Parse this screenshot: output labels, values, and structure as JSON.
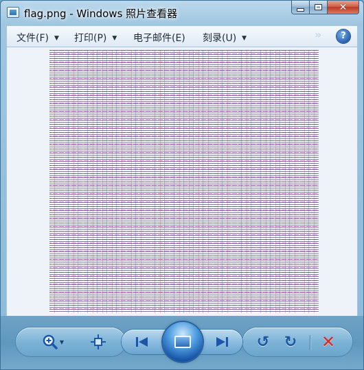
{
  "window": {
    "title": "flag.png - Windows 照片查看器"
  },
  "caption_buttons": {
    "close_glyph": "✕"
  },
  "menubar": {
    "items": [
      {
        "label": "文件(F)",
        "has_dropdown": true
      },
      {
        "label": "打印(P)",
        "has_dropdown": true
      },
      {
        "label": "电子邮件(E)",
        "has_dropdown": false
      },
      {
        "label": "刻录(U)",
        "has_dropdown": true
      }
    ],
    "dropdown_arrow": "▼",
    "chevron": "»",
    "help": "?"
  },
  "controls": {
    "zoom_icon": "magnifier-plus-icon",
    "zoom_dropdown": "▼",
    "fit_icon": "actual-size-icon",
    "prev_glyph": "⏮",
    "next_glyph": "⏭",
    "slideshow_icon": "slideshow-icon",
    "rotate_left_glyph": "↺",
    "rotate_right_glyph": "↻",
    "delete_glyph": "✕"
  },
  "colors": {
    "title_bar": "#9ec6e0",
    "control_bar": "#5f97bd",
    "delete": "#d62a2a",
    "nav_blue": "#1b56a8"
  }
}
